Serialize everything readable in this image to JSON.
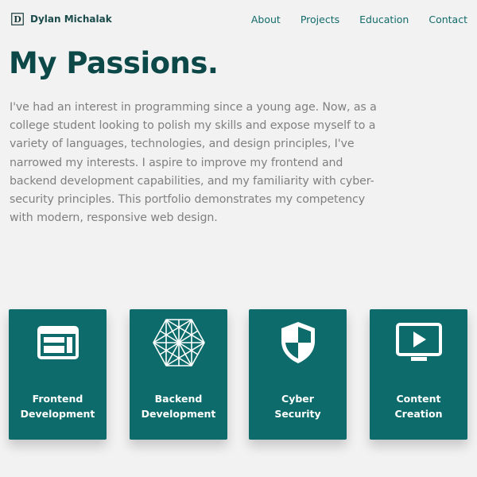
{
  "header": {
    "logo_letter": "D",
    "brand_name": "Dylan Michalak",
    "nav": [
      {
        "label": "About"
      },
      {
        "label": "Projects"
      },
      {
        "label": "Education"
      },
      {
        "label": "Contact"
      }
    ]
  },
  "main": {
    "title": "My Passions.",
    "intro": "I've had an interest in programming since a young age. Now, as a college student looking to polish my skills and expose myself to a variety of languages, technologies, and design principles, I've narrowed my interests. I aspire to improve my frontend and backend development capabilities, and my familiarity with cyber-security principles. This portfolio demonstrates my competency with modern, responsive web design.",
    "cards": [
      {
        "line1": "Frontend",
        "line2": "Development",
        "icon": "browser-window-icon"
      },
      {
        "line1": "Backend",
        "line2": "Development",
        "icon": "network-hexagon-icon"
      },
      {
        "line1": "Cyber",
        "line2": "Security",
        "icon": "shield-icon"
      },
      {
        "line1": "Content",
        "line2": "Creation",
        "icon": "video-play-icon"
      }
    ]
  },
  "colors": {
    "background": "#f2f2f2",
    "accent": "#0d6b6b",
    "title": "#0c4848",
    "body_text": "#808080",
    "nav_text": "#136a6a"
  }
}
